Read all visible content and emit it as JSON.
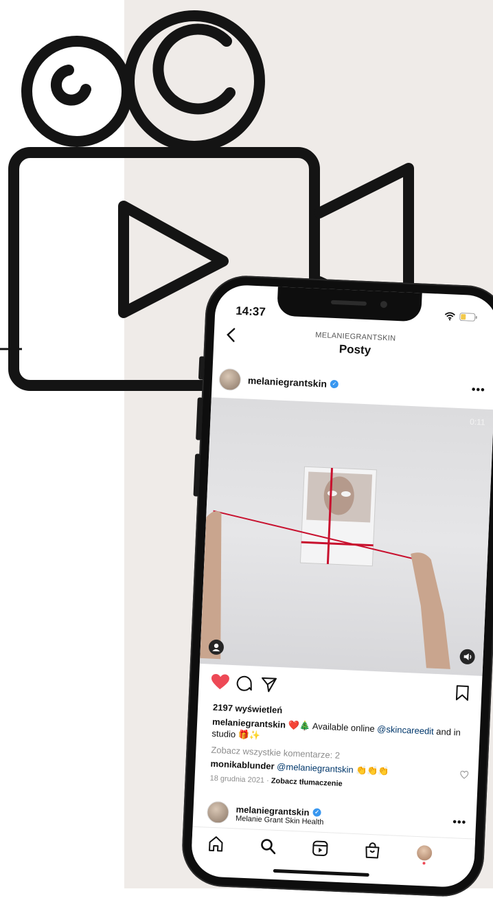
{
  "status": {
    "time": "14:37"
  },
  "nav": {
    "subtitle": "MELANIEGRANTSKIN",
    "title": "Posty"
  },
  "post": {
    "username": "melaniegrantskin",
    "timer": "0:11",
    "views": "2197 wyświetleń",
    "caption_user": "melaniegrantskin",
    "caption_text": " ❤️🎄 Available online ",
    "caption_mention": "@skincareedit",
    "caption_tail": " and in studio 🎁✨",
    "view_comments": "Zobacz wszystkie komentarze: 2",
    "comment_user": "monikablunder",
    "comment_mention": " @melaniegrantskin",
    "comment_emoji": " 👏👏👏",
    "date": "18 grudnia 2021",
    "date_sep": " · ",
    "translate": "Zobacz tłumaczenie"
  },
  "next_post": {
    "username": "melaniegrantskin",
    "subtitle": "Melanie Grant Skin Health"
  },
  "colors": {
    "like": "#ed4956",
    "verified": "#3897f0",
    "ribbon": "#c8102e",
    "background_panel": "#efebe8"
  },
  "icons": [
    "back-icon",
    "more-icon",
    "heart-icon",
    "comment-icon",
    "share-icon",
    "bookmark-icon",
    "home-icon",
    "search-icon",
    "reels-icon",
    "shop-icon",
    "profile-icon"
  ]
}
